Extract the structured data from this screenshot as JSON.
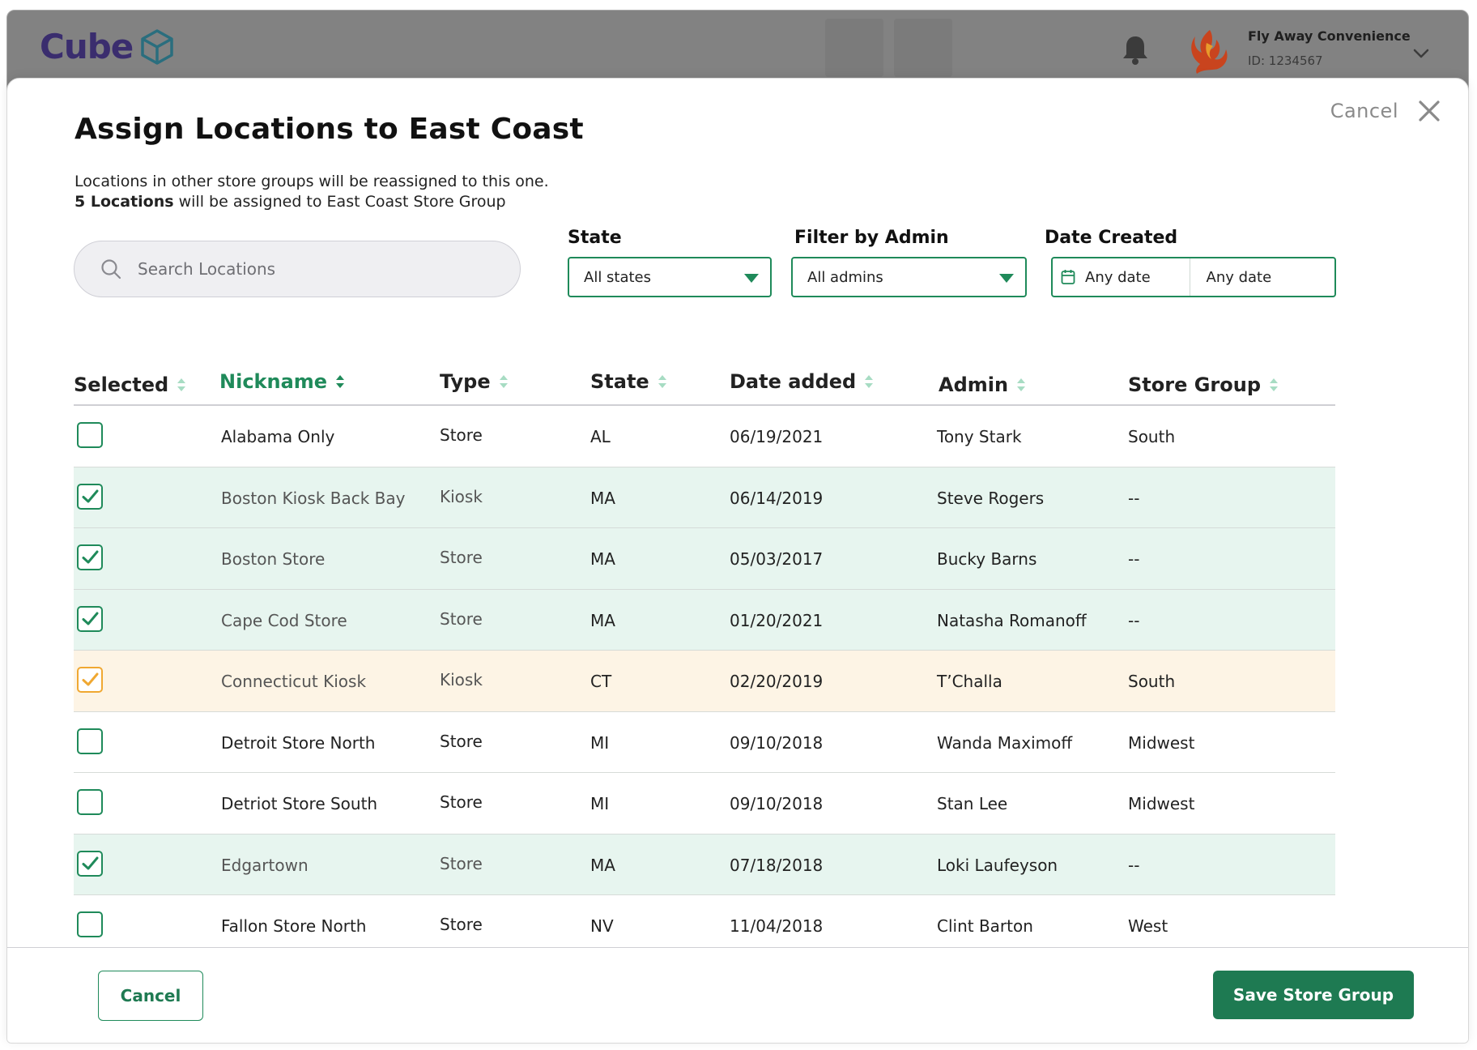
{
  "app": {
    "logo_text": "Cube",
    "account_name": "Fly Away Convenience",
    "account_id": "ID: 1234567"
  },
  "modal": {
    "cancel_label": "Cancel",
    "title": "Assign Locations to East Coast",
    "subtitle_line1": "Locations in other store groups will be reassigned to this one.",
    "assign_count": "5 Locations",
    "assign_suffix": " will be assigned to East Coast Store Group"
  },
  "search": {
    "placeholder": "Search Locations"
  },
  "filters": {
    "state": {
      "label": "State",
      "value": "All states"
    },
    "admin": {
      "label": "Filter by Admin",
      "value": "All admins"
    },
    "date": {
      "label": "Date Created",
      "from": "Any date",
      "to": "Any date"
    }
  },
  "table": {
    "columns": {
      "selected": "Selected",
      "nickname": "Nickname",
      "type": "Type",
      "state": "State",
      "date_added": "Date added",
      "admin": "Admin",
      "store_group": "Store Group"
    },
    "sorted_column": "nickname",
    "rows": [
      {
        "checked": false,
        "status": "none",
        "nickname": "Alabama Only",
        "type": "Store",
        "state": "AL",
        "date_added": "06/19/2021",
        "admin": "Tony Stark",
        "store_group": "South"
      },
      {
        "checked": true,
        "status": "selected",
        "nickname": "Boston Kiosk Back Bay",
        "type": "Kiosk",
        "state": "MA",
        "date_added": "06/14/2019",
        "admin": "Steve Rogers",
        "store_group": "--"
      },
      {
        "checked": true,
        "status": "selected",
        "nickname": "Boston Store",
        "type": "Store",
        "state": "MA",
        "date_added": "05/03/2017",
        "admin": "Bucky Barns",
        "store_group": "--"
      },
      {
        "checked": true,
        "status": "selected",
        "nickname": "Cape Cod Store",
        "type": "Store",
        "state": "MA",
        "date_added": "01/20/2021",
        "admin": "Natasha Romanoff",
        "store_group": "--"
      },
      {
        "checked": true,
        "status": "reassign",
        "nickname": "Connecticut Kiosk",
        "type": "Kiosk",
        "state": "CT",
        "date_added": "02/20/2019",
        "admin": "T’Challa",
        "store_group": "South"
      },
      {
        "checked": false,
        "status": "none",
        "nickname": "Detroit Store North",
        "type": "Store",
        "state": "MI",
        "date_added": "09/10/2018",
        "admin": "Wanda Maximoff",
        "store_group": "Midwest"
      },
      {
        "checked": false,
        "status": "none",
        "nickname": "Detriot Store South",
        "type": "Store",
        "state": "MI",
        "date_added": "09/10/2018",
        "admin": "Stan Lee",
        "store_group": "Midwest"
      },
      {
        "checked": true,
        "status": "selected",
        "nickname": "Edgartown",
        "type": "Store",
        "state": "MA",
        "date_added": "07/18/2018",
        "admin": "Loki Laufeyson",
        "store_group": "--"
      },
      {
        "checked": false,
        "status": "none",
        "nickname": "Fallon Store North",
        "type": "Store",
        "state": "NV",
        "date_added": "11/04/2018",
        "admin": "Clint Barton",
        "store_group": "West"
      }
    ]
  },
  "footer": {
    "cancel_label": "Cancel",
    "save_label": "Save Store Group"
  },
  "colors": {
    "accent": "#1f8a5a",
    "save_button": "#1e7a52",
    "selected_row": "#e7f5ef",
    "reassign_row": "#fdf4e5",
    "reassign_check": "#f0a832",
    "topbar": "#828282",
    "logo": "#3a2d6e"
  },
  "icons": {
    "logo": "cube-icon",
    "notifications": "bell-icon",
    "avatar": "phoenix-logo",
    "account_menu": "chevron-down-icon",
    "close": "close-icon",
    "search": "search-icon",
    "calendar": "calendar-icon",
    "sort": "sort-icon",
    "check": "checkmark-icon"
  }
}
